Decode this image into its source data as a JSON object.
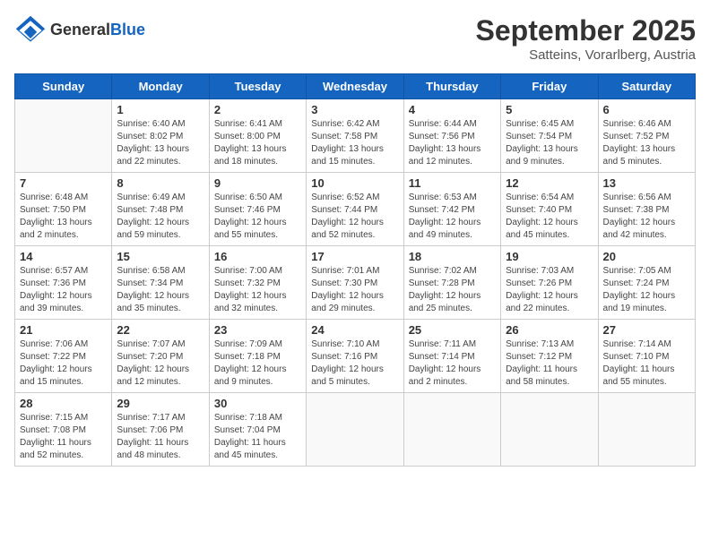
{
  "header": {
    "logo_general": "General",
    "logo_blue": "Blue",
    "month_title": "September 2025",
    "subtitle": "Satteins, Vorarlberg, Austria"
  },
  "weekdays": [
    "Sunday",
    "Monday",
    "Tuesday",
    "Wednesday",
    "Thursday",
    "Friday",
    "Saturday"
  ],
  "weeks": [
    [
      {
        "day": null
      },
      {
        "day": "1",
        "sunrise": "Sunrise: 6:40 AM",
        "sunset": "Sunset: 8:02 PM",
        "daylight": "Daylight: 13 hours and 22 minutes."
      },
      {
        "day": "2",
        "sunrise": "Sunrise: 6:41 AM",
        "sunset": "Sunset: 8:00 PM",
        "daylight": "Daylight: 13 hours and 18 minutes."
      },
      {
        "day": "3",
        "sunrise": "Sunrise: 6:42 AM",
        "sunset": "Sunset: 7:58 PM",
        "daylight": "Daylight: 13 hours and 15 minutes."
      },
      {
        "day": "4",
        "sunrise": "Sunrise: 6:44 AM",
        "sunset": "Sunset: 7:56 PM",
        "daylight": "Daylight: 13 hours and 12 minutes."
      },
      {
        "day": "5",
        "sunrise": "Sunrise: 6:45 AM",
        "sunset": "Sunset: 7:54 PM",
        "daylight": "Daylight: 13 hours and 9 minutes."
      },
      {
        "day": "6",
        "sunrise": "Sunrise: 6:46 AM",
        "sunset": "Sunset: 7:52 PM",
        "daylight": "Daylight: 13 hours and 5 minutes."
      }
    ],
    [
      {
        "day": "7",
        "sunrise": "Sunrise: 6:48 AM",
        "sunset": "Sunset: 7:50 PM",
        "daylight": "Daylight: 13 hours and 2 minutes."
      },
      {
        "day": "8",
        "sunrise": "Sunrise: 6:49 AM",
        "sunset": "Sunset: 7:48 PM",
        "daylight": "Daylight: 12 hours and 59 minutes."
      },
      {
        "day": "9",
        "sunrise": "Sunrise: 6:50 AM",
        "sunset": "Sunset: 7:46 PM",
        "daylight": "Daylight: 12 hours and 55 minutes."
      },
      {
        "day": "10",
        "sunrise": "Sunrise: 6:52 AM",
        "sunset": "Sunset: 7:44 PM",
        "daylight": "Daylight: 12 hours and 52 minutes."
      },
      {
        "day": "11",
        "sunrise": "Sunrise: 6:53 AM",
        "sunset": "Sunset: 7:42 PM",
        "daylight": "Daylight: 12 hours and 49 minutes."
      },
      {
        "day": "12",
        "sunrise": "Sunrise: 6:54 AM",
        "sunset": "Sunset: 7:40 PM",
        "daylight": "Daylight: 12 hours and 45 minutes."
      },
      {
        "day": "13",
        "sunrise": "Sunrise: 6:56 AM",
        "sunset": "Sunset: 7:38 PM",
        "daylight": "Daylight: 12 hours and 42 minutes."
      }
    ],
    [
      {
        "day": "14",
        "sunrise": "Sunrise: 6:57 AM",
        "sunset": "Sunset: 7:36 PM",
        "daylight": "Daylight: 12 hours and 39 minutes."
      },
      {
        "day": "15",
        "sunrise": "Sunrise: 6:58 AM",
        "sunset": "Sunset: 7:34 PM",
        "daylight": "Daylight: 12 hours and 35 minutes."
      },
      {
        "day": "16",
        "sunrise": "Sunrise: 7:00 AM",
        "sunset": "Sunset: 7:32 PM",
        "daylight": "Daylight: 12 hours and 32 minutes."
      },
      {
        "day": "17",
        "sunrise": "Sunrise: 7:01 AM",
        "sunset": "Sunset: 7:30 PM",
        "daylight": "Daylight: 12 hours and 29 minutes."
      },
      {
        "day": "18",
        "sunrise": "Sunrise: 7:02 AM",
        "sunset": "Sunset: 7:28 PM",
        "daylight": "Daylight: 12 hours and 25 minutes."
      },
      {
        "day": "19",
        "sunrise": "Sunrise: 7:03 AM",
        "sunset": "Sunset: 7:26 PM",
        "daylight": "Daylight: 12 hours and 22 minutes."
      },
      {
        "day": "20",
        "sunrise": "Sunrise: 7:05 AM",
        "sunset": "Sunset: 7:24 PM",
        "daylight": "Daylight: 12 hours and 19 minutes."
      }
    ],
    [
      {
        "day": "21",
        "sunrise": "Sunrise: 7:06 AM",
        "sunset": "Sunset: 7:22 PM",
        "daylight": "Daylight: 12 hours and 15 minutes."
      },
      {
        "day": "22",
        "sunrise": "Sunrise: 7:07 AM",
        "sunset": "Sunset: 7:20 PM",
        "daylight": "Daylight: 12 hours and 12 minutes."
      },
      {
        "day": "23",
        "sunrise": "Sunrise: 7:09 AM",
        "sunset": "Sunset: 7:18 PM",
        "daylight": "Daylight: 12 hours and 9 minutes."
      },
      {
        "day": "24",
        "sunrise": "Sunrise: 7:10 AM",
        "sunset": "Sunset: 7:16 PM",
        "daylight": "Daylight: 12 hours and 5 minutes."
      },
      {
        "day": "25",
        "sunrise": "Sunrise: 7:11 AM",
        "sunset": "Sunset: 7:14 PM",
        "daylight": "Daylight: 12 hours and 2 minutes."
      },
      {
        "day": "26",
        "sunrise": "Sunrise: 7:13 AM",
        "sunset": "Sunset: 7:12 PM",
        "daylight": "Daylight: 11 hours and 58 minutes."
      },
      {
        "day": "27",
        "sunrise": "Sunrise: 7:14 AM",
        "sunset": "Sunset: 7:10 PM",
        "daylight": "Daylight: 11 hours and 55 minutes."
      }
    ],
    [
      {
        "day": "28",
        "sunrise": "Sunrise: 7:15 AM",
        "sunset": "Sunset: 7:08 PM",
        "daylight": "Daylight: 11 hours and 52 minutes."
      },
      {
        "day": "29",
        "sunrise": "Sunrise: 7:17 AM",
        "sunset": "Sunset: 7:06 PM",
        "daylight": "Daylight: 11 hours and 48 minutes."
      },
      {
        "day": "30",
        "sunrise": "Sunrise: 7:18 AM",
        "sunset": "Sunset: 7:04 PM",
        "daylight": "Daylight: 11 hours and 45 minutes."
      },
      {
        "day": null
      },
      {
        "day": null
      },
      {
        "day": null
      },
      {
        "day": null
      }
    ]
  ]
}
